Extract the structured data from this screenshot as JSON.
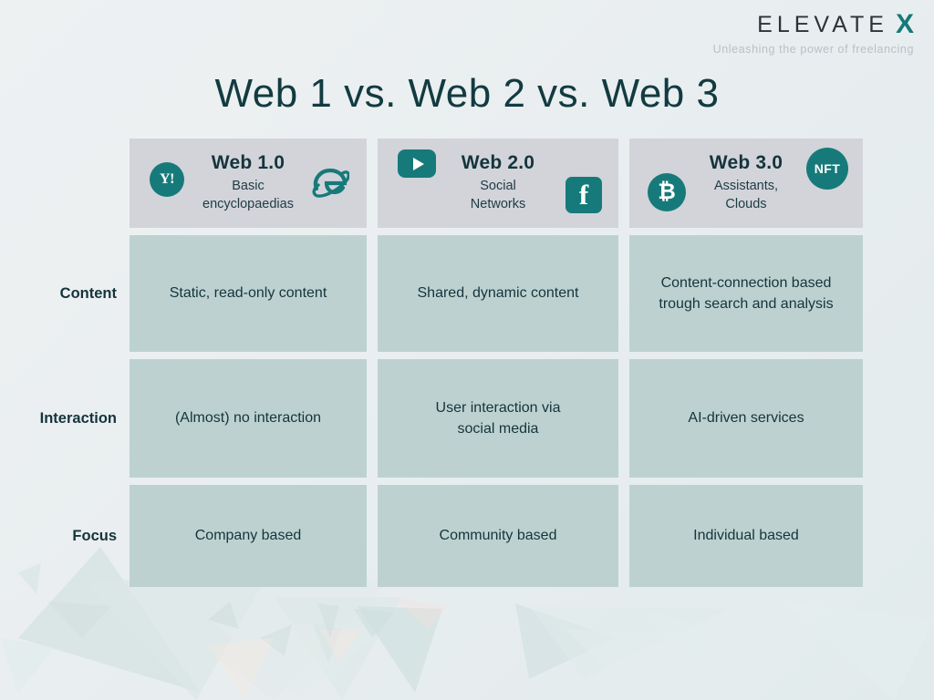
{
  "brand": {
    "name": "ELEVATE",
    "mark": "X",
    "tagline": "Unleashing the power of freelancing",
    "accent_color": "#16797a",
    "word_color": "#2a3338",
    "tagline_color": "#b9bfc3"
  },
  "page_title": "Web 1 vs. Web 2 vs. Web 3",
  "theme": {
    "background": "#e9eef0",
    "header_cell_bg": "#d2d4da",
    "body_cell_bg": "#bdd2d0",
    "text_color": "#15343c",
    "icon_teal": "#177a7a"
  },
  "columns": [
    {
      "key": "web1",
      "title": "Web 1.0",
      "subtitle": "Basic\nencyclopaedias",
      "subtitle_lines": [
        "Basic",
        "encyclopaedias"
      ],
      "icons": [
        {
          "name": "yahoo-icon",
          "label": "Y!",
          "position": "left"
        },
        {
          "name": "internet-explorer-icon",
          "label": "e",
          "position": "right"
        }
      ]
    },
    {
      "key": "web2",
      "title": "Web 2.0",
      "subtitle": "Social\nNetworks",
      "subtitle_lines": [
        "Social",
        "Networks"
      ],
      "icons": [
        {
          "name": "youtube-icon",
          "label": "▶",
          "position": "top-left"
        },
        {
          "name": "facebook-icon",
          "label": "f",
          "position": "bottom-right"
        }
      ]
    },
    {
      "key": "web3",
      "title": "Web 3.0",
      "subtitle": "Assistants,\nClouds",
      "subtitle_lines": [
        "Assistants,",
        "Clouds"
      ],
      "icons": [
        {
          "name": "bitcoin-icon",
          "label": "₿",
          "position": "bottom-left"
        },
        {
          "name": "nft-badge-icon",
          "label": "NFT",
          "position": "top-right"
        }
      ]
    }
  ],
  "rows": [
    {
      "key": "content",
      "label": "Content",
      "cells": [
        {
          "lines": [
            "Static, read-only content"
          ]
        },
        {
          "lines": [
            "Shared, dynamic content"
          ]
        },
        {
          "lines": [
            "Content-connection based",
            "trough search and analysis"
          ]
        }
      ]
    },
    {
      "key": "interaction",
      "label": "Interaction",
      "cells": [
        {
          "lines": [
            "(Almost) no interaction"
          ]
        },
        {
          "lines": [
            "User interaction via",
            "social media"
          ]
        },
        {
          "lines": [
            "AI-driven services"
          ]
        }
      ]
    },
    {
      "key": "focus",
      "label": "Focus",
      "cells": [
        {
          "lines": [
            "Company based"
          ]
        },
        {
          "lines": [
            "Community based"
          ]
        },
        {
          "lines": [
            "Individual based"
          ]
        }
      ]
    }
  ]
}
